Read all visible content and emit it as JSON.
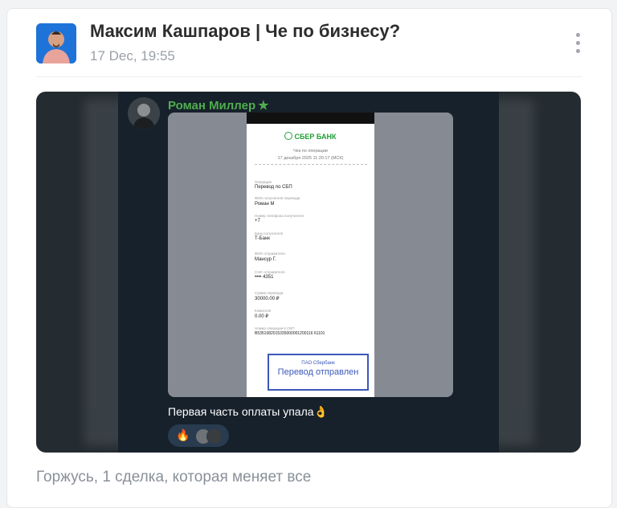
{
  "post": {
    "author": "Максим Кашпаров | Че по бизнесу?",
    "date": "17 Dec, 19:55",
    "text": "Горжусь, 1 сделка, которая меняет все",
    "more_icon": "more-vertical-icon"
  },
  "screenshot": {
    "sender_name": "Роман Миллер",
    "sender_badge_icon": "star-icon",
    "caption": "Первая часть оплаты упала👌",
    "reaction": {
      "emoji": "🔥",
      "icon": "fire-icon"
    },
    "receipt": {
      "brand": "СБЕР БАНК",
      "title": "Чек по операции",
      "datetime": "17 декабря 2025 11:20:17 (МСК)",
      "fields": [
        {
          "label": "Операция",
          "value": "Перевод по СБП"
        },
        {
          "label": "ФИО получателя перевода",
          "value": "Роман М"
        },
        {
          "label": "Номер телефона получателя",
          "value": "+7"
        },
        {
          "label": "Банк получателя",
          "value": "Т-Банк"
        },
        {
          "label": "ФИО отправителя",
          "value": "Мансур Г."
        },
        {
          "label": "Счёт отправителя",
          "value": "•••• 4351"
        },
        {
          "label": "Сумма перевода",
          "value": "30000.00 ₽"
        },
        {
          "label": "Комиссия",
          "value": "0.00 ₽"
        },
        {
          "label": "Номер операции в СБП",
          "value": "B5351082015335000001200116 61101"
        }
      ],
      "stamp_org": "ПАО Сбербанк",
      "stamp_text": "Перевод отправлен"
    }
  },
  "colors": {
    "accent_green": "#4fae4e",
    "stamp_blue": "#3c58b8",
    "sber_green": "#21a038"
  }
}
